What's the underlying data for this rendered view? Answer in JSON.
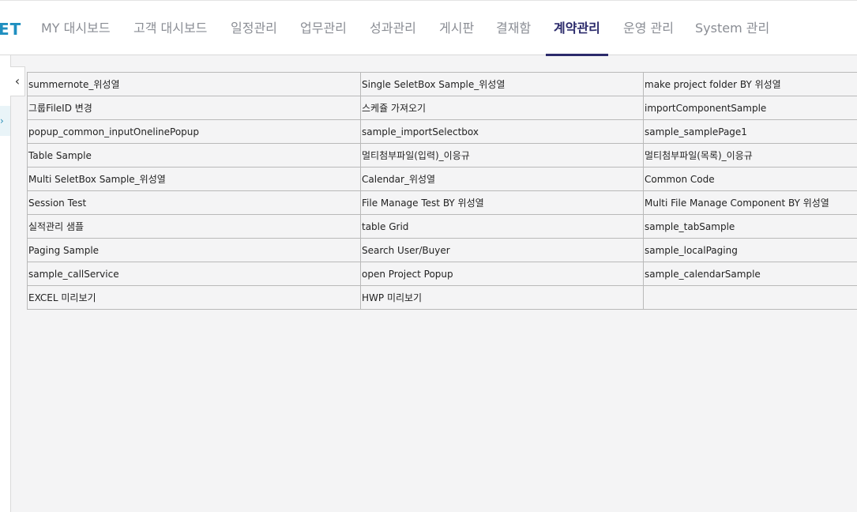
{
  "header": {
    "logo_text": "ET",
    "nav": [
      {
        "label": "MY 대시보드",
        "active": false
      },
      {
        "label": "고객 대시보드",
        "active": false
      },
      {
        "label": "일정관리",
        "active": false
      },
      {
        "label": "업무관리",
        "active": false
      },
      {
        "label": "성과관리",
        "active": false
      },
      {
        "label": "게시판",
        "active": false
      },
      {
        "label": "결재함",
        "active": false
      },
      {
        "label": "계약관리",
        "active": true
      },
      {
        "label": "운영 관리",
        "active": false
      },
      {
        "label": "System 관리",
        "active": false
      }
    ]
  },
  "sidebar": {
    "collapse_icon": "chevron-left-icon",
    "expand_icon": "chevron-right-icon"
  },
  "sample_table": {
    "rows": [
      [
        "summernote_위성열",
        "Single SeletBox Sample_위성열",
        "make project folder BY 위성열"
      ],
      [
        "그룹FileID 변경",
        "스케쥴 가져오기",
        "importComponentSample"
      ],
      [
        "popup_common_inputOnelinePopup",
        "sample_importSelectbox",
        "sample_samplePage1"
      ],
      [
        "Table Sample",
        "멀티첨부파일(입력)_이응규",
        "멀티첨부파일(목록)_이응규"
      ],
      [
        "Multi SeletBox Sample_위성열",
        "Calendar_위성열",
        "Common Code"
      ],
      [
        "Session Test",
        "File Manage Test BY 위성열",
        "Multi File Manage Component BY 위성열"
      ],
      [
        "실적관리 샘플",
        "table Grid",
        "sample_tabSample"
      ],
      [
        "Paging Sample",
        "Search User/Buyer",
        "sample_localPaging"
      ],
      [
        "sample_callService",
        "open Project Popup",
        "sample_calendarSample"
      ],
      [
        "EXCEL 미리보기",
        "HWP 미리보기",
        ""
      ]
    ]
  },
  "colors": {
    "accent": "#2b2a6b",
    "logo": "#1f8fc0",
    "nav_inactive": "#8a8d94",
    "background": "#f4f4f5"
  }
}
